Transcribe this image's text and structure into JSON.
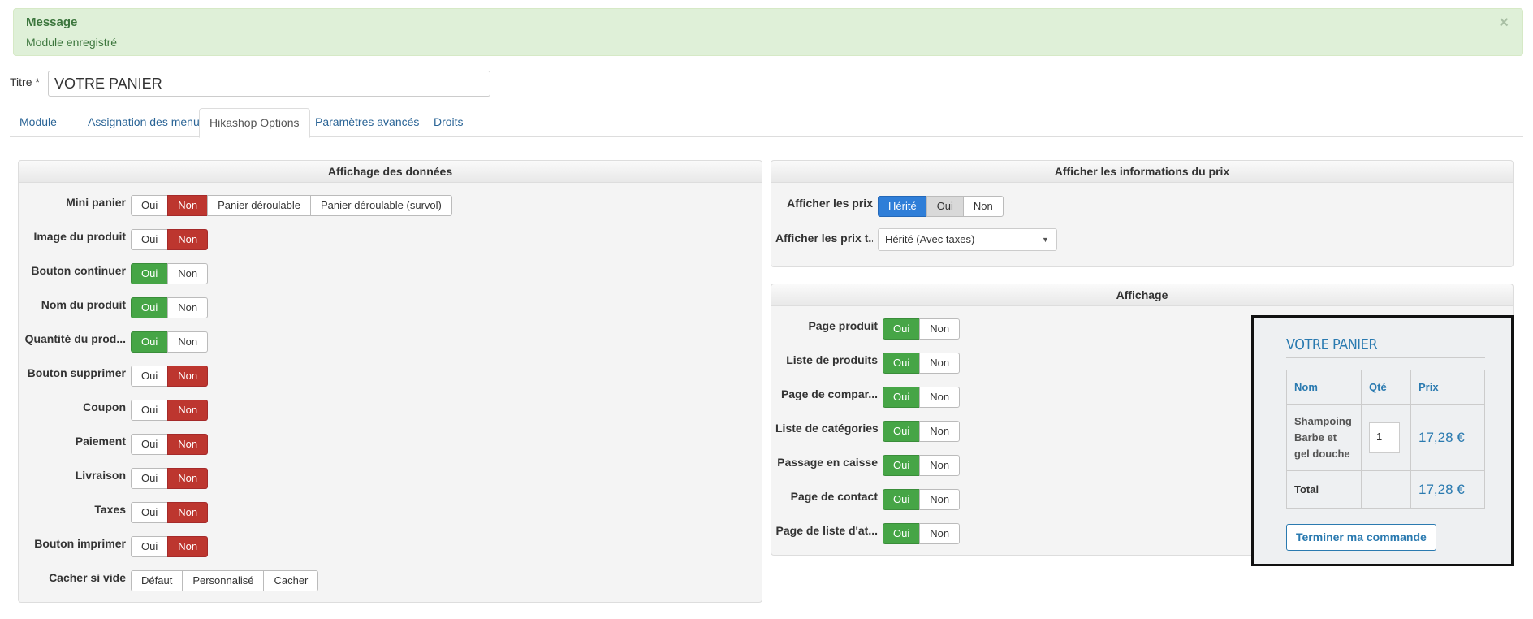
{
  "message": {
    "title": "Message",
    "text": "Module enregistré",
    "close_icon": "×"
  },
  "title_field": {
    "label": "Titre *",
    "value": "VOTRE PANIER"
  },
  "tabs": [
    {
      "label": "Module",
      "active": false
    },
    {
      "label": "Assignation des menus",
      "active": false
    },
    {
      "label": "Hikashop Options",
      "active": true
    },
    {
      "label": "Paramètres avancés",
      "active": false
    },
    {
      "label": "Droits",
      "active": false
    }
  ],
  "data_panel": {
    "title": "Affichage des données",
    "rows": [
      {
        "label": "Mini panier",
        "options": [
          "Oui",
          "Non",
          "Panier déroulable",
          "Panier déroulable (survol)"
        ],
        "selected": "Non"
      },
      {
        "label": "Image du produit",
        "options": [
          "Oui",
          "Non"
        ],
        "selected": "Non"
      },
      {
        "label": "Bouton continuer",
        "options": [
          "Oui",
          "Non"
        ],
        "selected": "Oui"
      },
      {
        "label": "Nom du produit",
        "options": [
          "Oui",
          "Non"
        ],
        "selected": "Oui"
      },
      {
        "label": "Quantité du prod...",
        "options": [
          "Oui",
          "Non"
        ],
        "selected": "Oui"
      },
      {
        "label": "Bouton supprimer",
        "options": [
          "Oui",
          "Non"
        ],
        "selected": "Non"
      },
      {
        "label": "Coupon",
        "options": [
          "Oui",
          "Non"
        ],
        "selected": "Non"
      },
      {
        "label": "Paiement",
        "options": [
          "Oui",
          "Non"
        ],
        "selected": "Non"
      },
      {
        "label": "Livraison",
        "options": [
          "Oui",
          "Non"
        ],
        "selected": "Non"
      },
      {
        "label": "Taxes",
        "options": [
          "Oui",
          "Non"
        ],
        "selected": "Non"
      },
      {
        "label": "Bouton imprimer",
        "options": [
          "Oui",
          "Non"
        ],
        "selected": "Non"
      },
      {
        "label": "Cacher si vide",
        "options": [
          "Défaut",
          "Personnalisé",
          "Cacher"
        ],
        "selected": ""
      }
    ]
  },
  "price_panel": {
    "title": "Afficher les informations du prix",
    "show_prices": {
      "label": "Afficher les prix",
      "options": [
        "Hérité",
        "Oui",
        "Non"
      ],
      "selected": "Hérité",
      "hover": "Oui"
    },
    "price_type": {
      "label": "Afficher les prix t...",
      "value": "Hérité (Avec taxes)"
    }
  },
  "display_panel": {
    "title": "Affichage",
    "rows": [
      {
        "label": "Page produit",
        "options": [
          "Oui",
          "Non"
        ],
        "selected": "Oui"
      },
      {
        "label": "Liste de produits",
        "options": [
          "Oui",
          "Non"
        ],
        "selected": "Oui"
      },
      {
        "label": "Page de compar...",
        "options": [
          "Oui",
          "Non"
        ],
        "selected": "Oui"
      },
      {
        "label": "Liste de catégories",
        "options": [
          "Oui",
          "Non"
        ],
        "selected": "Oui"
      },
      {
        "label": "Passage en caisse",
        "options": [
          "Oui",
          "Non"
        ],
        "selected": "Oui"
      },
      {
        "label": "Page de contact",
        "options": [
          "Oui",
          "Non"
        ],
        "selected": "Oui"
      },
      {
        "label": "Page de liste d'at...",
        "options": [
          "Oui",
          "Non"
        ],
        "selected": "Oui"
      }
    ]
  },
  "cart_preview": {
    "title": "VOTRE PANIER",
    "headers": {
      "name": "Nom",
      "qty": "Qté",
      "price": "Prix"
    },
    "item": {
      "name": "Shampoing Barbe et gel douche",
      "qty": "1",
      "price": "17,28 €"
    },
    "total_label": "Total",
    "total_value": "17,28 €",
    "checkout_label": "Terminer ma commande"
  },
  "colors": {
    "red": "#bd362f",
    "green": "#46a546",
    "blue": "#2f7ed8",
    "link": "#2a6496"
  }
}
